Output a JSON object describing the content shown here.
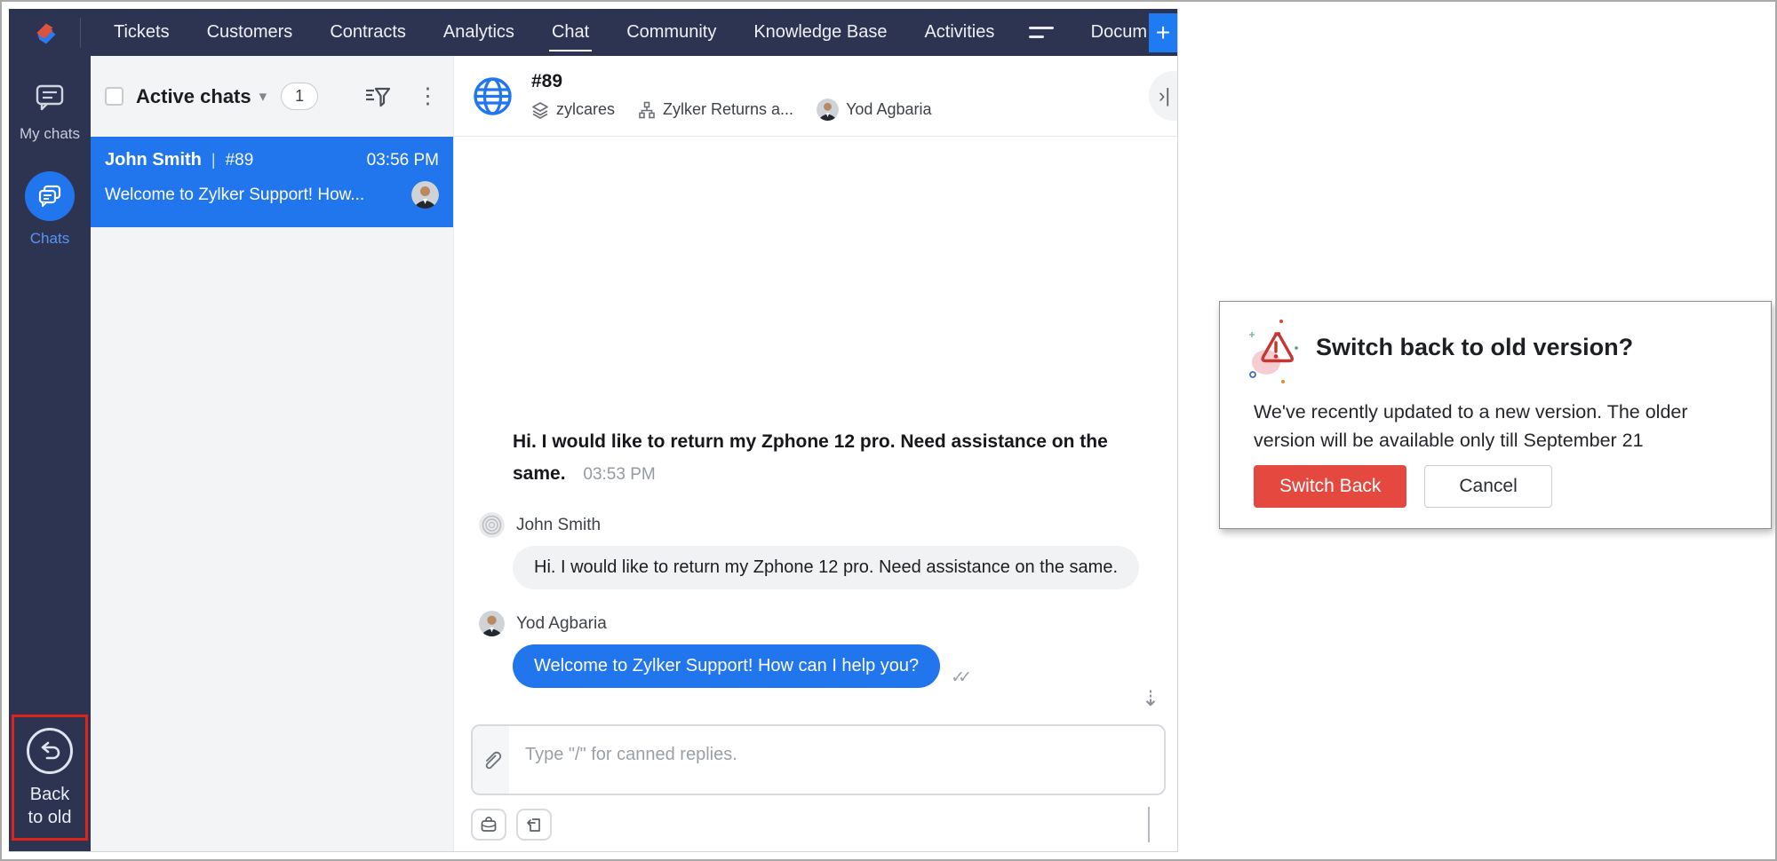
{
  "nav": {
    "items": [
      "Tickets",
      "Customers",
      "Contracts",
      "Analytics",
      "Chat",
      "Community",
      "Knowledge Base",
      "Activities"
    ],
    "active_item": "Chat",
    "more_label": "Docum",
    "add_label": "+"
  },
  "sidebar": {
    "my_chats_label": "My chats",
    "chats_label": "Chats",
    "back_line1": "Back",
    "back_line2": "to old"
  },
  "chat_list": {
    "title": "Active chats",
    "count": "1",
    "item": {
      "name": "John Smith",
      "sep": "|",
      "ticket": "#89",
      "time": "03:56 PM",
      "preview": "Welcome to Zylker Support! How..."
    }
  },
  "conv": {
    "ticket": "#89",
    "portal": "zylcares",
    "department": "Zylker Returns a...",
    "agent": "Yod Agbaria",
    "pinned_text": "Hi. I would like to return my Zphone 12 pro. Need assistance on the same.",
    "pinned_time": "03:53 PM",
    "msg1_sender": "John Smith",
    "msg1_text": "Hi. I would like to return my Zphone 12 pro. Need assistance on the same.",
    "msg2_sender": "Yod Agbaria",
    "msg2_text": "Welcome to Zylker Support! How can I help you?",
    "composer_placeholder": "Type \"/\" for canned replies."
  },
  "modal": {
    "title": "Switch back to old version?",
    "body": "We've recently updated to a new version. The older version will be available only till September 21",
    "primary_label": "Switch Back",
    "secondary_label": "Cancel"
  },
  "icons": {
    "caret": "▾",
    "kebab": "⋮",
    "read_marks": "✓✓",
    "scroll_down": "⇣",
    "collapse": "›|"
  },
  "colors": {
    "nav_bg": "#2d3452",
    "accent_blue": "#2176ee",
    "danger_red": "#e5483f",
    "highlight_red": "#e0241b"
  }
}
